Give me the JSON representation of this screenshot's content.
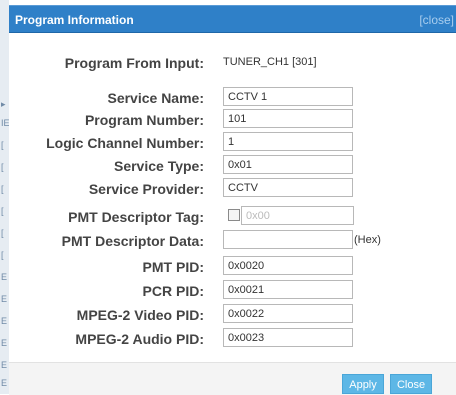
{
  "dialog": {
    "title": "Program Information",
    "close_label": "[close]"
  },
  "fields": {
    "program_from_input": {
      "label": "Program From Input:",
      "value": "TUNER_CH1 [301]"
    },
    "service_name": {
      "label": "Service Name:",
      "value": "CCTV 1"
    },
    "program_number": {
      "label": "Program Number:",
      "value": "101"
    },
    "logic_channel_number": {
      "label": "Logic Channel Number:",
      "value": "1"
    },
    "service_type": {
      "label": "Service Type:",
      "value": "0x01"
    },
    "service_provider": {
      "label": "Service Provider:",
      "value": "CCTV"
    },
    "pmt_descriptor_tag": {
      "label": "PMT Descriptor Tag:",
      "value": "0x00",
      "checked": false
    },
    "pmt_descriptor_data": {
      "label": "PMT Descriptor Data:",
      "value": "",
      "suffix": "(Hex)"
    },
    "pmt_pid": {
      "label": "PMT PID:",
      "value": "0x0020"
    },
    "pcr_pid": {
      "label": "PCR PID:",
      "value": "0x0021"
    },
    "video_pid": {
      "label": "MPEG-2 Video PID:",
      "value": "0x0022"
    },
    "audio_pid": {
      "label": "MPEG-2 Audio PID:",
      "value": "0x0023"
    }
  },
  "buttons": {
    "apply_label": "Apply",
    "close_label": "Close"
  },
  "colors": {
    "title_bar": "#2f80c8",
    "button": "#5db7e6"
  }
}
